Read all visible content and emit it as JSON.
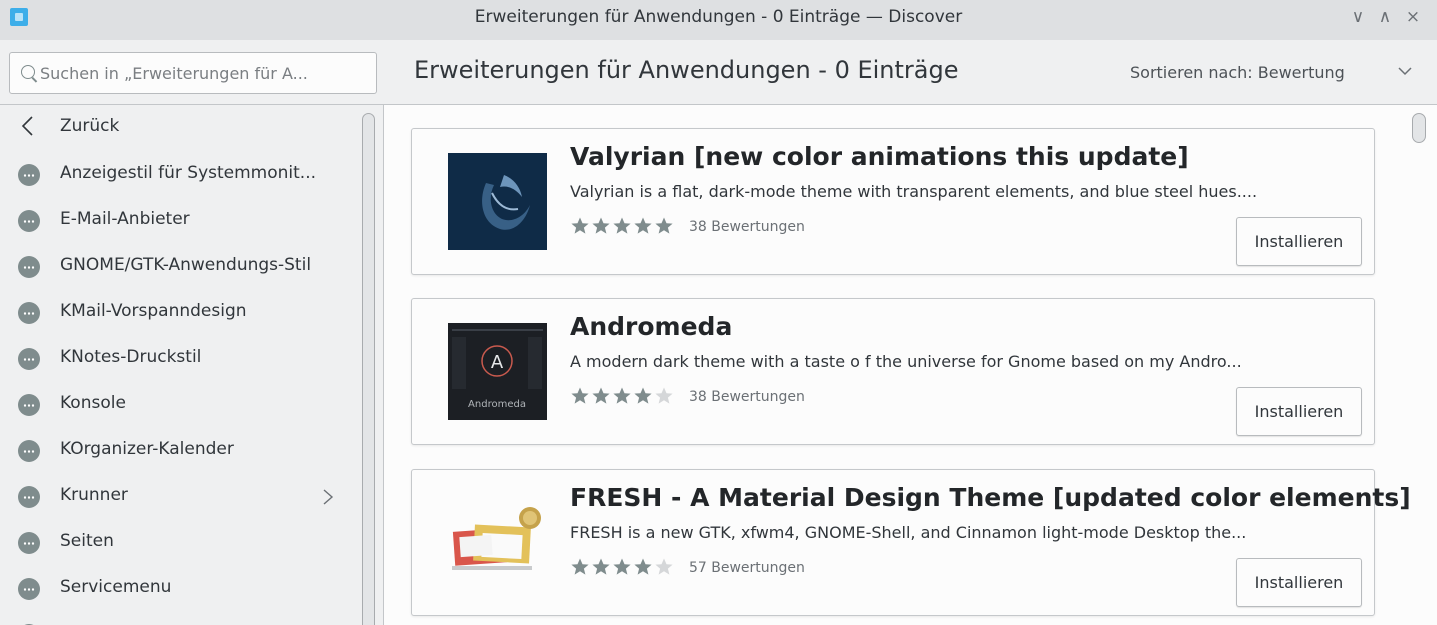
{
  "window": {
    "title": "Erweiterungen für Anwendungen - 0 Einträge — Discover",
    "controls": {
      "minimize": "∨",
      "maximize": "∧",
      "close": "×"
    }
  },
  "header": {
    "search_placeholder": "Suchen in „Erweiterungen für A...",
    "page_title": "Erweiterungen für Anwendungen - 0 Einträge",
    "sort_label": "Sortieren nach: Bewertung"
  },
  "sidebar": {
    "back_label": "Zurück",
    "items": [
      {
        "label": "Anzeigestil für Systemmonit..."
      },
      {
        "label": "E-Mail-Anbieter"
      },
      {
        "label": "GNOME/GTK-Anwendungs-Stil"
      },
      {
        "label": "KMail-Vorspanndesign"
      },
      {
        "label": "KNotes-Druckstil"
      },
      {
        "label": "Konsole"
      },
      {
        "label": "KOrganizer-Kalender"
      },
      {
        "label": "Krunner",
        "has_submenu": true
      },
      {
        "label": "Seiten"
      },
      {
        "label": "Servicemenu"
      }
    ]
  },
  "results": [
    {
      "title": "Valyrian [new color animations this update]",
      "description": "Valyrian is a flat, dark-mode theme with transparent elements, and blue steel hues....",
      "rating_stars": 5,
      "ratings_text": "38 Bewertungen",
      "install_label": "Installieren"
    },
    {
      "title": "Andromeda",
      "description": " A modern dark theme with a taste o f the universe for Gnome based on my  Andro...",
      "rating_stars": 4,
      "ratings_text": "38 Bewertungen",
      "install_label": "Installieren",
      "thumbnail_text": "Andromeda",
      "thumbnail_letter": "A"
    },
    {
      "title": "FRESH - A Material Design Theme [updated color elements]",
      "description": "FRESH is a new GTK, xfwm4, GNOME-Shell, and Cinnamon light-mode Desktop the...",
      "rating_stars": 4,
      "ratings_text": "57 Bewertungen",
      "install_label": "Installieren"
    }
  ],
  "colors": {
    "accent": "#3daee9",
    "window_bg": "#eff0f1",
    "titlebar_bg": "#dee0e2",
    "card_bg": "#fcfcfc",
    "star": "#7f8c8d",
    "star_empty": "#d5d7d9",
    "valyrian_bg": "#0f2b47",
    "andromeda_bg": "#1c1f24"
  }
}
